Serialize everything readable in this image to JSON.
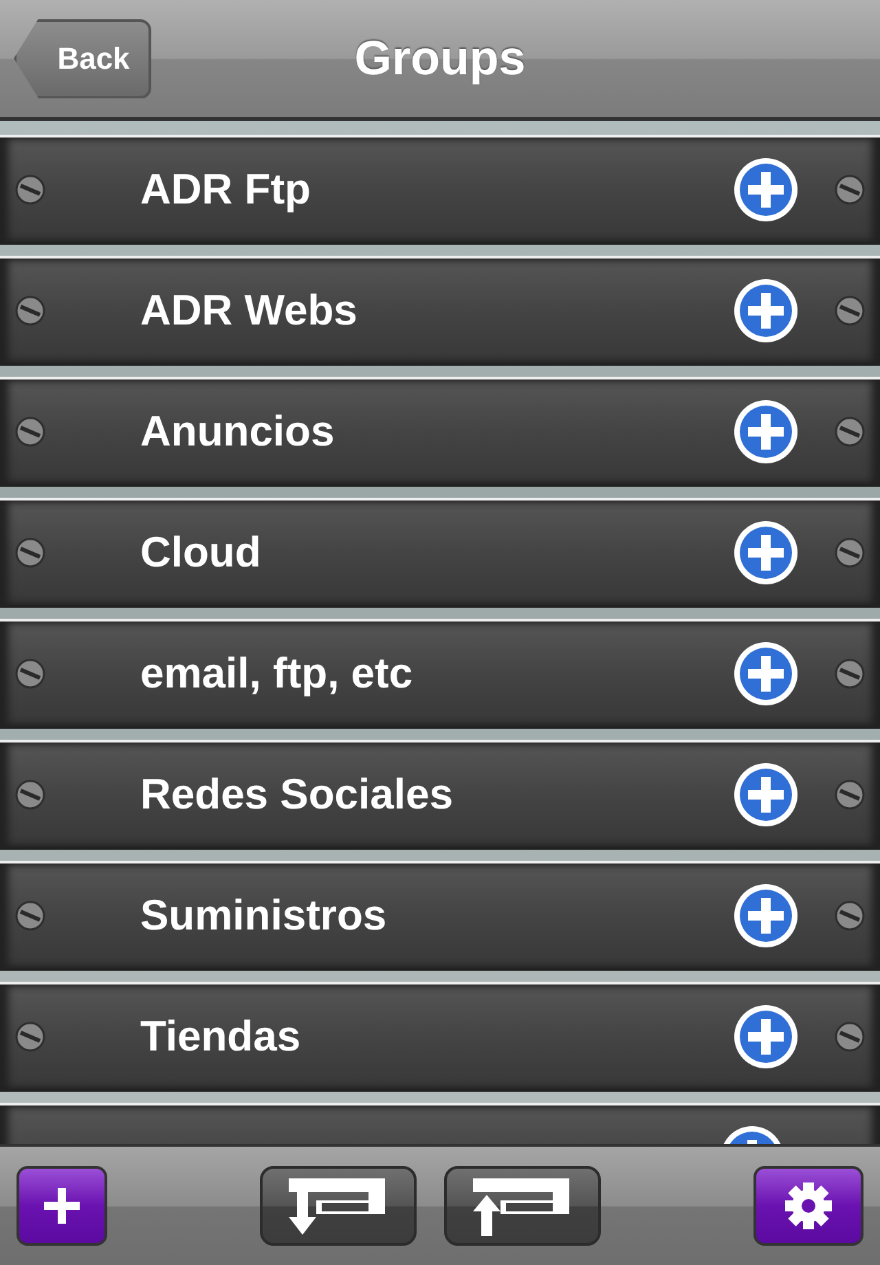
{
  "nav_bar": {
    "title": "Groups",
    "back_button": "Back"
  },
  "groups": [
    {
      "name": "ADR Ftp"
    },
    {
      "name": "ADR Webs"
    },
    {
      "name": "Anuncios"
    },
    {
      "name": "Cloud"
    },
    {
      "name": "email, ftp, etc"
    },
    {
      "name": "Redes Sociales"
    },
    {
      "name": "Suministros"
    },
    {
      "name": "Tiendas"
    }
  ]
}
